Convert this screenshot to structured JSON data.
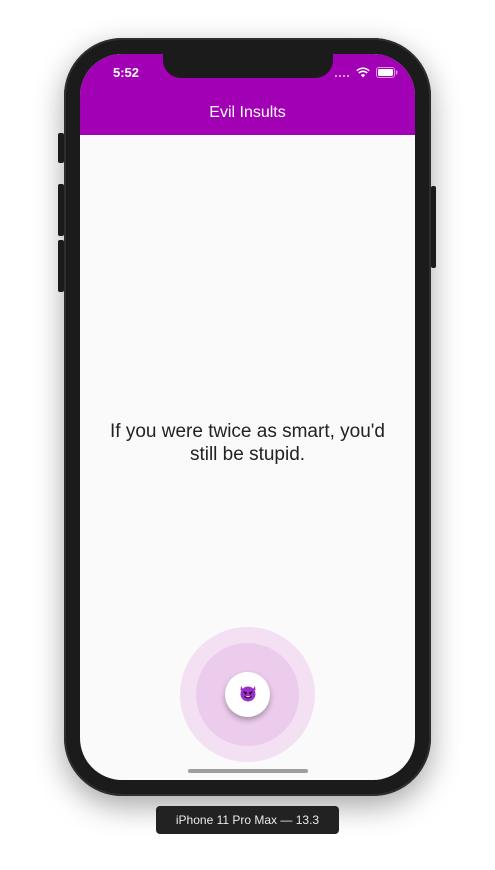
{
  "status_bar": {
    "time": "5:52",
    "icons": [
      "cellular-signal-icon",
      "wifi-icon",
      "battery-icon"
    ]
  },
  "app_bar": {
    "title": "Evil Insults",
    "color": "#a200b5"
  },
  "content": {
    "insult_text": "If you were twice as smart, you'd still be stupid."
  },
  "fab": {
    "icon": "smiling-devil-icon",
    "ripple_color": "#ecccec"
  },
  "simulator": {
    "device_label": "iPhone 11 Pro Max — 13.3"
  }
}
